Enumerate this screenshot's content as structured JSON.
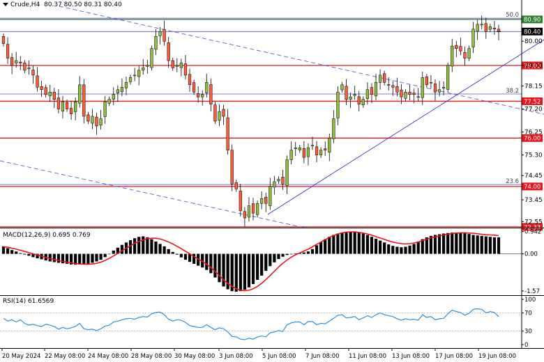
{
  "header": {
    "symbol": "Crude,H4",
    "ohlc": "80.37 80.50 80.31 80.40"
  },
  "macd_label": "MACD(12,26,9) 0.695 0.769",
  "rsi_label": "RSI(14) 61.6569",
  "colors": {
    "candle_up": "#8fbc3f",
    "candle_down": "#ff5a3a",
    "wick": "#000000",
    "horizontal_red": "#e8151b",
    "horizontal_green": "#2e7d32",
    "fib_line": "#4f4fd0",
    "trend_blue": "#3232c8",
    "macd_signal": "#e8151b",
    "macd_hist": "#000000",
    "rsi_line": "#2b8fe0"
  },
  "chart_data": [
    {
      "type": "candlestick",
      "title": "Crude,H4",
      "y_ticks": [
        "80.00",
        "79.00",
        "78.15",
        "77.20",
        "76.25",
        "75.30",
        "74.45",
        "73.45",
        "72.55"
      ],
      "ylim": [
        72.3,
        81.3
      ],
      "x_ticks": [
        "20 May 2024",
        "22 May 08:00",
        "24 May 08:00",
        "28 May 08:00",
        "30 May 08:00",
        "3 Jun 08:00",
        "5 Jun 08:00",
        "7 Jun 08:00",
        "11 Jun 08:00",
        "13 Jun 08:00",
        "17 Jun 08:00",
        "19 Jun 08:00"
      ],
      "current_price": 80.4,
      "price_tags": [
        {
          "value": 80.9,
          "label": "80.90",
          "style": "green"
        },
        {
          "value": 80.4,
          "label": "80.40",
          "style": "dark"
        },
        {
          "value": 79.0,
          "label": "79.00",
          "style": "red"
        },
        {
          "value": 77.52,
          "label": "77.52",
          "style": "red"
        },
        {
          "value": 76.0,
          "label": "76.00",
          "style": "red"
        },
        {
          "value": 74.0,
          "label": "74.00",
          "style": "red"
        },
        {
          "value": 72.33,
          "label": "72.33",
          "style": "red"
        }
      ],
      "fib_levels": [
        {
          "label": "50.0",
          "value": 80.95
        },
        {
          "label": "38.2",
          "value": 77.82
        },
        {
          "label": "23.6",
          "value": 74.08
        }
      ],
      "closes": [
        79.9,
        79.3,
        79.0,
        79.2,
        79.1,
        78.8,
        78.9,
        78.6,
        78.1,
        78.0,
        77.8,
        77.9,
        77.6,
        77.2,
        77.5,
        77.2,
        77.0,
        77.5,
        78.2,
        76.9,
        76.7,
        76.9,
        76.5,
        76.8,
        77.5,
        77.6,
        77.8,
        78.0,
        78.1,
        78.3,
        78.5,
        78.6,
        78.8,
        78.9,
        79.0,
        79.7,
        80.2,
        80.4,
        80.0,
        79.2,
        78.9,
        79.0,
        79.1,
        78.6,
        78.2,
        77.9,
        77.7,
        77.8,
        78.3,
        77.4,
        76.7,
        77.1,
        76.9,
        75.5,
        74.1,
        73.9,
        73.0,
        72.7,
        73.2,
        72.9,
        73.3,
        73.5,
        73.3,
        74.0,
        74.2,
        74.3,
        74.1,
        75.1,
        75.5,
        75.6,
        75.6,
        75.2,
        75.6,
        75.7,
        75.3,
        75.5,
        75.5,
        76.0,
        76.8,
        77.9,
        78.2,
        77.6,
        77.7,
        77.8,
        77.4,
        77.6,
        78.0,
        77.8,
        78.3,
        78.6,
        78.3,
        78.2,
        78.1,
        77.9,
        77.7,
        77.9,
        77.8,
        77.8,
        77.7,
        78.5,
        78.2,
        78.3,
        77.9,
        78.0,
        78.1,
        79.0,
        79.8,
        79.7,
        79.6,
        79.3,
        79.7,
        80.5,
        80.7,
        80.7,
        80.4,
        80.6,
        80.5,
        80.4
      ]
    },
    {
      "type": "bar",
      "title": "MACD(12,26,9)",
      "indicator": "MACD",
      "y_ticks": [
        "0.942",
        "0.00",
        "-1.57"
      ],
      "ylim": [
        -1.75,
        1.08
      ],
      "macd_value": 0.695,
      "signal_value": 0.769,
      "histogram": [
        0.32,
        0.24,
        0.16,
        0.1,
        0.03,
        -0.03,
        -0.08,
        -0.14,
        -0.19,
        -0.23,
        -0.28,
        -0.32,
        -0.35,
        -0.38,
        -0.4,
        -0.42,
        -0.45,
        -0.46,
        -0.45,
        -0.44,
        -0.42,
        -0.38,
        -0.32,
        -0.25,
        -0.14,
        0.0,
        0.14,
        0.26,
        0.38,
        0.48,
        0.58,
        0.66,
        0.72,
        0.74,
        0.7,
        0.62,
        0.52,
        0.42,
        0.32,
        0.2,
        0.08,
        -0.03,
        -0.15,
        -0.25,
        -0.34,
        -0.42,
        -0.5,
        -0.58,
        -0.68,
        -0.82,
        -1.0,
        -1.2,
        -1.38,
        -1.5,
        -1.58,
        -1.6,
        -1.58,
        -1.52,
        -1.42,
        -1.28,
        -1.1,
        -0.92,
        -0.72,
        -0.52,
        -0.36,
        -0.22,
        -0.12,
        -0.05,
        0.0,
        0.02,
        0.04,
        0.06,
        0.1,
        0.2,
        0.36,
        0.5,
        0.62,
        0.72,
        0.8,
        0.86,
        0.9,
        0.92,
        0.94,
        0.93,
        0.9,
        0.86,
        0.8,
        0.72,
        0.64,
        0.56,
        0.48,
        0.4,
        0.34,
        0.3,
        0.28,
        0.3,
        0.35,
        0.42,
        0.52,
        0.62,
        0.7,
        0.76,
        0.8,
        0.83,
        0.86,
        0.88,
        0.9,
        0.9,
        0.89,
        0.87,
        0.84,
        0.8,
        0.78,
        0.76,
        0.74,
        0.72,
        0.7,
        0.7
      ],
      "signal": [
        0.3,
        0.28,
        0.24,
        0.2,
        0.15,
        0.1,
        0.05,
        0.0,
        -0.05,
        -0.1,
        -0.15,
        -0.2,
        -0.24,
        -0.28,
        -0.32,
        -0.35,
        -0.38,
        -0.41,
        -0.43,
        -0.44,
        -0.44,
        -0.43,
        -0.4,
        -0.35,
        -0.28,
        -0.19,
        -0.09,
        0.02,
        0.13,
        0.24,
        0.34,
        0.44,
        0.52,
        0.59,
        0.64,
        0.66,
        0.66,
        0.63,
        0.57,
        0.5,
        0.42,
        0.32,
        0.22,
        0.11,
        0.0,
        -0.11,
        -0.22,
        -0.32,
        -0.44,
        -0.58,
        -0.74,
        -0.92,
        -1.1,
        -1.25,
        -1.38,
        -1.48,
        -1.54,
        -1.56,
        -1.54,
        -1.48,
        -1.38,
        -1.25,
        -1.09,
        -0.92,
        -0.74,
        -0.56,
        -0.4,
        -0.26,
        -0.14,
        -0.04,
        0.04,
        0.12,
        0.2,
        0.3,
        0.4,
        0.5,
        0.6,
        0.7,
        0.78,
        0.84,
        0.89,
        0.92,
        0.93,
        0.93,
        0.91,
        0.88,
        0.84,
        0.79,
        0.73,
        0.67,
        0.61,
        0.55,
        0.5,
        0.46,
        0.43,
        0.42,
        0.43,
        0.46,
        0.5,
        0.56,
        0.62,
        0.67,
        0.72,
        0.76,
        0.8,
        0.83,
        0.86,
        0.88,
        0.89,
        0.89,
        0.88,
        0.87,
        0.85,
        0.83,
        0.81,
        0.8,
        0.79,
        0.77
      ]
    },
    {
      "type": "line",
      "title": "RSI(14)",
      "indicator": "RSI",
      "y_ticks": [
        "100",
        "70",
        "30",
        "0"
      ],
      "ylim": [
        0,
        100
      ],
      "levels": [
        70,
        30
      ],
      "value": 61.6569,
      "values": [
        58,
        52,
        55,
        50,
        55,
        47,
        43,
        45,
        42,
        40,
        45,
        43,
        40,
        34,
        38,
        35,
        37,
        40,
        47,
        35,
        33,
        34,
        31,
        35,
        41,
        43,
        50,
        52,
        55,
        57,
        58,
        56,
        60,
        62,
        61,
        68,
        71,
        72,
        66,
        56,
        52,
        55,
        54,
        49,
        42,
        40,
        38,
        38,
        44,
        38,
        33,
        37,
        35,
        28,
        18,
        17,
        12,
        11,
        14,
        12,
        17,
        19,
        17,
        26,
        28,
        31,
        29,
        44,
        48,
        50,
        50,
        44,
        51,
        51,
        44,
        47,
        46,
        52,
        58,
        65,
        66,
        59,
        60,
        62,
        55,
        59,
        64,
        60,
        66,
        70,
        66,
        64,
        62,
        57,
        54,
        57,
        55,
        56,
        54,
        66,
        60,
        62,
        55,
        57,
        58,
        68,
        76,
        73,
        71,
        65,
        69,
        78,
        79,
        78,
        70,
        73,
        71,
        62
      ]
    }
  ]
}
